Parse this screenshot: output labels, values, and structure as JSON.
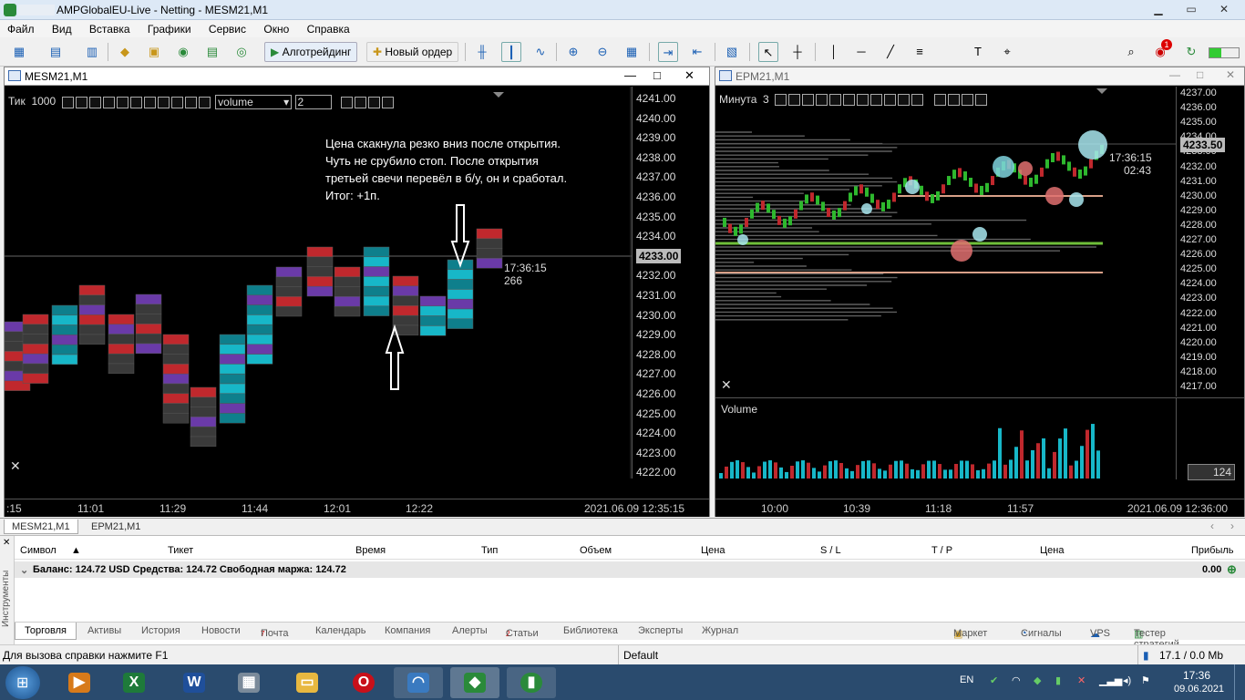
{
  "app": {
    "title": "AMPGlobalEU-Live - Netting - MESM21,M1",
    "menu": [
      "Файл",
      "Вид",
      "Вставка",
      "Графики",
      "Сервис",
      "Окно",
      "Справка"
    ],
    "toolbar": {
      "algo_label": "Алготрейдинг",
      "new_order_label": "Новый ордер"
    }
  },
  "left_chart": {
    "window_title": "MESM21,M1",
    "mode_label": "Тик",
    "mode_value": "1000",
    "indicator_select": "volume",
    "indicator_param": "2",
    "annotation": [
      "Цена скакнула резко вниз после открытия.",
      "Чуть не срубило стоп. После открытия",
      "третьей свечи перевёл в б/у, он и сработал.",
      "Итог: +1п."
    ],
    "timer": "17:36:15",
    "timer_count": "266",
    "current_price": "4233.00",
    "price_scale": [
      "4241.00",
      "4240.00",
      "4239.00",
      "4238.00",
      "4237.00",
      "4236.00",
      "4235.00",
      "4234.00",
      "4233.00",
      "4232.00",
      "4231.00",
      "4230.00",
      "4229.00",
      "4228.00",
      "4227.00",
      "4226.00",
      "4225.00",
      "4224.00",
      "4223.00",
      "4222.00"
    ],
    "time_scale": [
      ":15",
      "11:01",
      "11:29",
      "11:44",
      "12:01",
      "12:22"
    ],
    "datetime": "2021.06.09 12:35:15"
  },
  "right_chart": {
    "window_title": "EPM21,M1",
    "mode_label": "Минута",
    "mode_value": "3",
    "timer": "17:36:15",
    "timer_count": "02:43",
    "current_price": "4233.50",
    "price_scale": [
      "4237.00",
      "4236.00",
      "4235.00",
      "4234.00",
      "4233.00",
      "4232.00",
      "4231.00",
      "4230.00",
      "4229.00",
      "4228.00",
      "4227.00",
      "4226.00",
      "4225.00",
      "4224.00",
      "4223.00",
      "4222.00",
      "4221.00",
      "4220.00",
      "4219.00",
      "4218.00",
      "4217.00"
    ],
    "volume_label": "Volume",
    "volume_value": "124",
    "time_scale": [
      "10:00",
      "10:39",
      "11:18",
      "11:57"
    ],
    "datetime": "2021.06.09 12:36:00"
  },
  "chart_tabs": [
    "MESM21,M1",
    "EPM21,M1"
  ],
  "terminal": {
    "side_label": "Инструменты",
    "columns": [
      "Символ",
      "Тикет",
      "Время",
      "Тип",
      "Объем",
      "Цена",
      "S / L",
      "T / P",
      "Цена",
      "Прибыль"
    ],
    "balance_text": "Баланс: 124.72 USD  Средства: 124.72  Свободная маржа: 124.72",
    "profit": "0.00",
    "tabs": [
      "Торговля",
      "Активы",
      "История",
      "Новости",
      "Почта",
      "Календарь",
      "Компания",
      "Алерты",
      "Статьи",
      "Библиотека",
      "Эксперты",
      "Журнал"
    ],
    "mail_badge": "7",
    "articles_badge": "2",
    "right_tabs": [
      "Маркет",
      "Сигналы",
      "VPS",
      "Тестер стратегий"
    ]
  },
  "status": {
    "help": "Для вызова справки нажмите F1",
    "profile": "Default",
    "traffic": "17.1 / 0.0 Mb"
  },
  "taskbar": {
    "lang": "EN",
    "time": "17:36",
    "date": "09.06.2021",
    "notif_badge": "1"
  },
  "colors": {
    "bull": "#17b7c8",
    "bear": "#c0282d",
    "bg": "#000000",
    "poc_green": "#6fbf3a"
  }
}
